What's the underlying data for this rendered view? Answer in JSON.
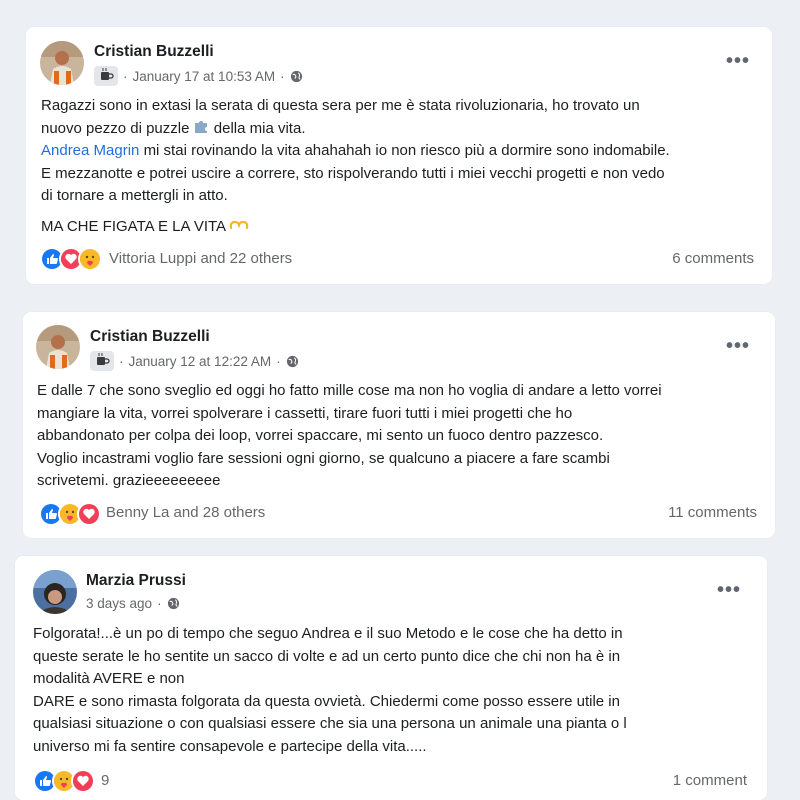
{
  "posts": [
    {
      "author": "Cristian Buzzelli",
      "time": "January 17 at 10:53 AM",
      "lines": [
        "Ragazzi sono in extasi la serata di questa sera per me è stata rivoluzionaria, ho trovato un",
        "nuovo pezzo di puzzle",
        "della mia vita.",
        "Andrea Magrin",
        "mi stai rovinando la vita ahahahah io non riesco più a dormire sono indomabile.",
        "E mezzanotte e potrei uscire a correre, sto rispolverando tutti i miei vecchi progetti e non vedo",
        "di tornare a mettergli in atto.",
        "MA CHE FIGATA E LA VITA"
      ],
      "reactors": "Vittoria Luppi and 22 others",
      "comments": "6 comments"
    },
    {
      "author": "Cristian Buzzelli",
      "time": "January 12 at 12:22 AM",
      "lines": [
        "E dalle 7 che sono sveglio ed oggi ho fatto mille cose ma non ho voglia di andare a letto vorrei",
        "mangiare la vita, vorrei spolverare i cassetti, tirare fuori tutti i miei progetti che ho",
        "abbandonato per colpa dei loop, vorrei spaccare, mi sento un fuoco dentro pazzesco.",
        "Voglio incastrami voglio fare sessioni ogni giorno, se qualcuno a piacere a fare scambi",
        "scrivetemi. grazieeeeeeeee"
      ],
      "reactors": "Benny La and 28 others",
      "comments": "11 comments"
    },
    {
      "author": "Marzia Prussi",
      "time": "3 days ago",
      "lines": [
        "Folgorata!...è  un po di tempo che seguo Andrea e il suo Metodo e le cose che ha detto in",
        "queste serate le ho sentite un sacco di volte e ad un certo punto dice che chi non ha è  in",
        "modalità AVERE e non",
        "DARE e sono rimasta folgorata da questa ovvietà. Chiedermi come posso essere utile in",
        "qualsiasi situazione o con qualsiasi essere che sia una persona un animale una pianta o l",
        "universo mi fa sentire consapevole e partecipe della vita....."
      ],
      "reactors": "9",
      "comments": "1 comment"
    }
  ],
  "ui": {
    "dot": "·",
    "more": "•••",
    "reactions": [
      "like",
      "love",
      "care"
    ],
    "icons": [
      "coffee-badge-icon",
      "globe-icon",
      "puzzle-icon",
      "heart-hands-icon",
      "more-options-icon"
    ],
    "colors": {
      "link": "#216fdb",
      "like": "#1877f2",
      "love": "#f33e58",
      "care": "#f7b928",
      "meta": "#65676b"
    }
  }
}
